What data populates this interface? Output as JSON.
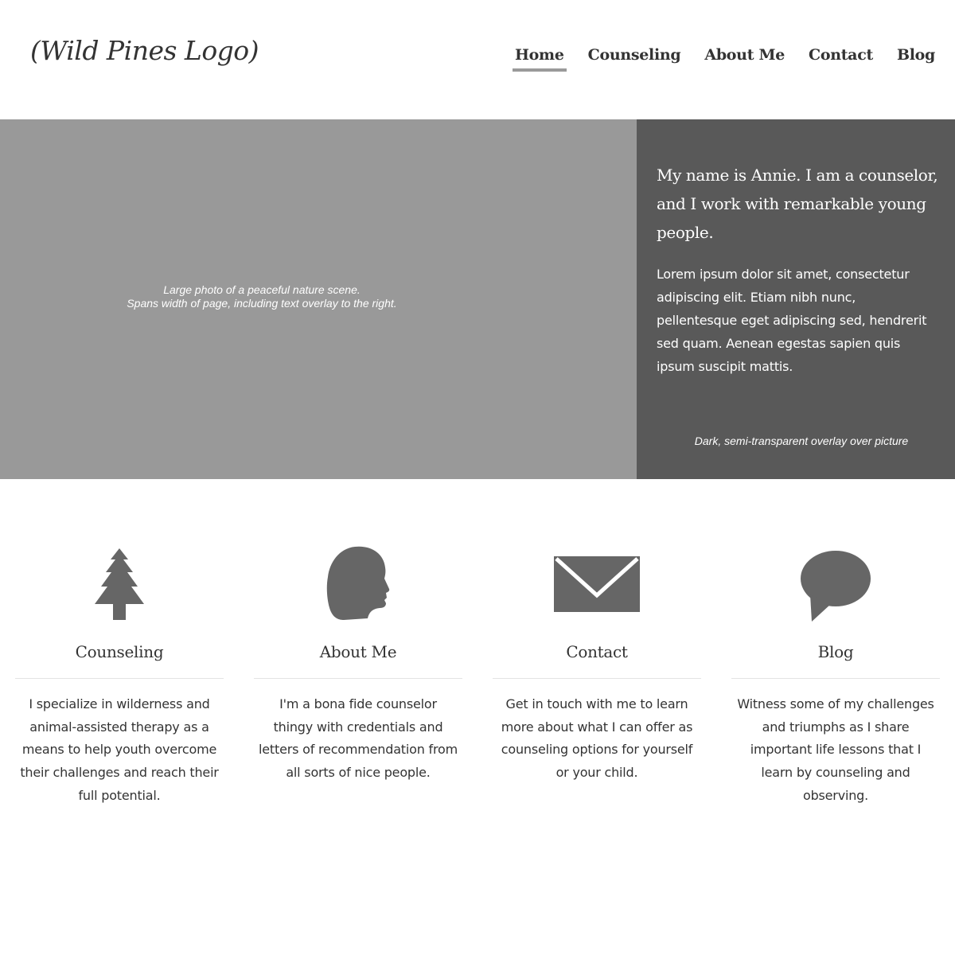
{
  "header": {
    "logo_text": "(Wild Pines Logo)",
    "nav": [
      {
        "label": "Home",
        "active": true
      },
      {
        "label": "Counseling",
        "active": false
      },
      {
        "label": "About Me",
        "active": false
      },
      {
        "label": "Contact",
        "active": false
      },
      {
        "label": "Blog",
        "active": false
      }
    ]
  },
  "hero": {
    "photo_caption_line1": "Large photo of a peaceful nature scene.",
    "photo_caption_line2": "Spans width of page, including text overlay to the right.",
    "heading": "My name is Annie.  I am a counselor, and I work with remarkable young people.",
    "body": "Lorem ipsum dolor sit amet, consectetur adipiscing elit. Etiam nibh nunc, pellentesque eget adipiscing sed, hendrerit sed quam. Aenean egestas sapien quis ipsum suscipit mattis.",
    "overlay_note": "Dark, semi-transparent overlay over picture"
  },
  "features": [
    {
      "icon": "tree-icon",
      "title": "Counseling",
      "text": "I specialize in wilderness and animal-assisted therapy as a means to help youth overcome their challenges and reach their full potential."
    },
    {
      "icon": "head-silhouette-icon",
      "title": "About Me",
      "text": "I'm a bona fide counselor thingy with credentials and letters of recommendation from all sorts of nice people."
    },
    {
      "icon": "envelope-icon",
      "title": "Contact",
      "text": "Get in touch with me to learn more about what I can offer as counseling options for yourself or your child."
    },
    {
      "icon": "speech-bubble-icon",
      "title": "Blog",
      "text": "Witness some of my challenges and triumphs as I share important life lessons that I learn by counseling and observing."
    }
  ],
  "colors": {
    "photo_placeholder": "#999999",
    "overlay": "#595959",
    "icon": "#666666",
    "nav_active_underline": "#9a9a9a"
  }
}
